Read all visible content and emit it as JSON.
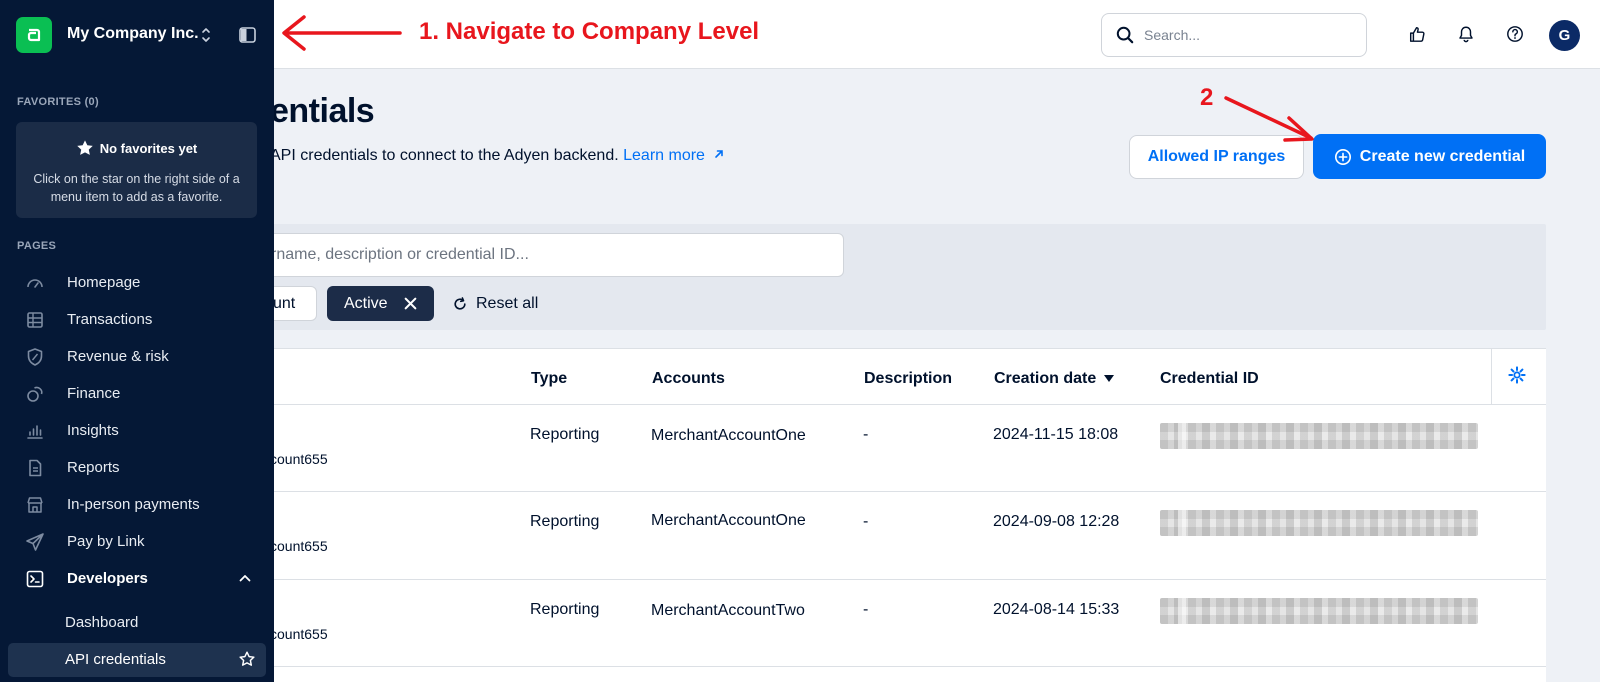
{
  "topbar": {
    "search_placeholder": "Search...",
    "avatar_initial": "G"
  },
  "page": {
    "title": "entials",
    "description": "API credentials to connect to the Adyen backend.",
    "learn_more": "Learn more",
    "allowed_ip_button": "Allowed IP ranges",
    "create_button": "Create new credential"
  },
  "filters": {
    "search_value": "rname, description or credential ID...",
    "account_chip": "unt",
    "active_chip": "Active",
    "reset_all": "Reset all"
  },
  "table": {
    "headers": {
      "type": "Type",
      "accounts": "Accounts",
      "description": "Description",
      "creation_date": "Creation date",
      "credential_id": "Credential ID"
    },
    "rows": [
      {
        "sub": "count655",
        "type": "Reporting",
        "account": "MerchantAccountOne",
        "description": "-",
        "date": "2024-11-15 18:08"
      },
      {
        "sub": "count655",
        "type": "Reporting",
        "account": "MerchantAccountOne",
        "description": "-",
        "date": "2024-09-08 12:28"
      },
      {
        "sub": "count655",
        "type": "Reporting",
        "account": "MerchantAccountTwo",
        "description": "-",
        "date": "2024-08-14 15:33"
      }
    ]
  },
  "sidebar": {
    "company": "My Company Inc.",
    "favorites_label": "FAVORITES (0)",
    "fav_title": "No favorites yet",
    "fav_text": "Click on the star on the right side of a menu item to add as a favorite.",
    "pages_label": "PAGES",
    "items": [
      {
        "label": "Homepage",
        "icon": "gauge-icon"
      },
      {
        "label": "Transactions",
        "icon": "table-icon"
      },
      {
        "label": "Revenue & risk",
        "icon": "shield-icon"
      },
      {
        "label": "Finance",
        "icon": "coins-icon"
      },
      {
        "label": "Insights",
        "icon": "bar-chart-icon"
      },
      {
        "label": "Reports",
        "icon": "document-icon"
      },
      {
        "label": "In-person payments",
        "icon": "store-icon"
      },
      {
        "label": "Pay by Link",
        "icon": "paper-plane-icon"
      },
      {
        "label": "Developers",
        "icon": "terminal-icon"
      }
    ],
    "sub_items": [
      {
        "label": "Dashboard"
      },
      {
        "label": "API credentials"
      }
    ]
  },
  "annotations": {
    "step1": "1. Navigate to Company Level",
    "step2": "2",
    "color": "#e8161d"
  },
  "colors": {
    "primary": "#0070f5",
    "sidebar_bg": "#051836",
    "logo_green": "#0abf53"
  }
}
